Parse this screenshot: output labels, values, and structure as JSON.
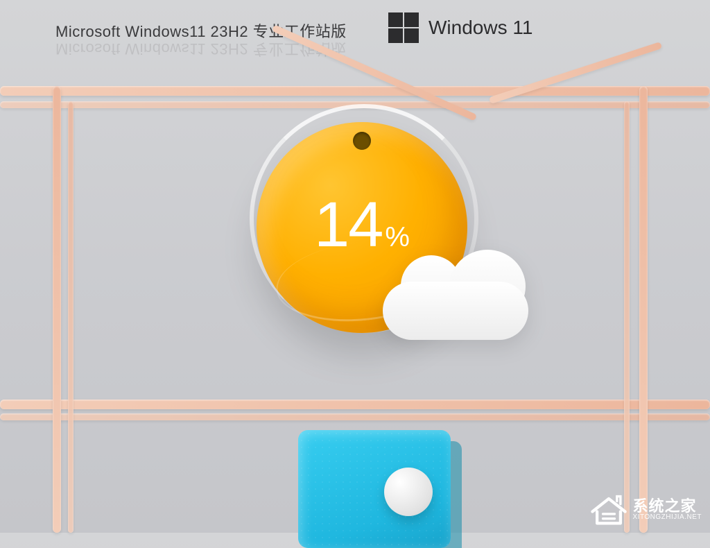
{
  "title": "Microsoft Windows11 23H2 专业工作站版",
  "brand": {
    "name": "Windows 11"
  },
  "progress": {
    "value": "14",
    "unit": "%"
  },
  "watermark": {
    "name_cn": "系统之家",
    "name_en": "XITONGZHIJIA.NET"
  },
  "colors": {
    "disk": "#ffb000",
    "cyan": "#1fb7df",
    "frame": "#ecb69c",
    "bg": "#cbccd0"
  }
}
